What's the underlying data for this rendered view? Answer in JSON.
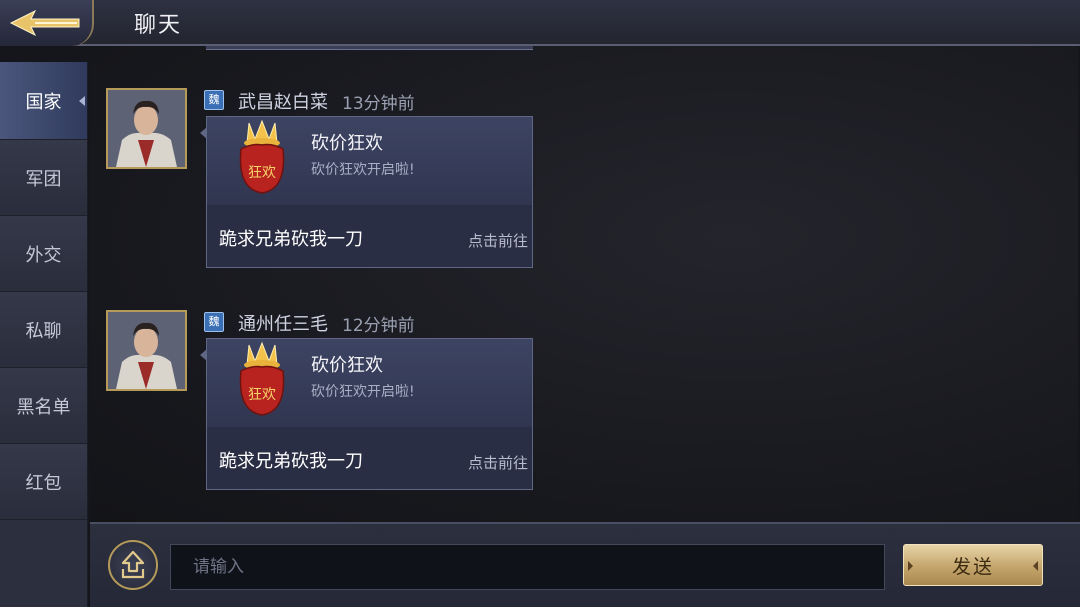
{
  "header": {
    "title": "聊天",
    "back_icon": "back-arrow-icon"
  },
  "sidebar": {
    "tabs": [
      {
        "label": "国家",
        "active": true
      },
      {
        "label": "军团",
        "active": false
      },
      {
        "label": "外交",
        "active": false
      },
      {
        "label": "私聊",
        "active": false
      },
      {
        "label": "黑名单",
        "active": false
      },
      {
        "label": "红包",
        "active": false
      }
    ]
  },
  "messages": [
    {
      "country": "魏",
      "sender": "武昌赵白菜",
      "time": "13分钟前",
      "card": {
        "title": "砍价狂欢",
        "subtitle": "砍价狂欢开启啦!",
        "bag_text": "狂欢",
        "message": "跪求兄弟砍我一刀",
        "action": "点击前往"
      }
    },
    {
      "country": "魏",
      "sender": "通州任三毛",
      "time": "12分钟前",
      "card": {
        "title": "砍价狂欢",
        "subtitle": "砍价狂欢开启啦!",
        "bag_text": "狂欢",
        "message": "跪求兄弟砍我一刀",
        "action": "点击前往"
      }
    }
  ],
  "input": {
    "placeholder": "请输入",
    "value": ""
  },
  "send_button": {
    "label": "发送"
  },
  "colors": {
    "accent_gold": "#c4a56c",
    "badge_blue": "#3a6fb5",
    "active_tab": "#4a567c"
  }
}
